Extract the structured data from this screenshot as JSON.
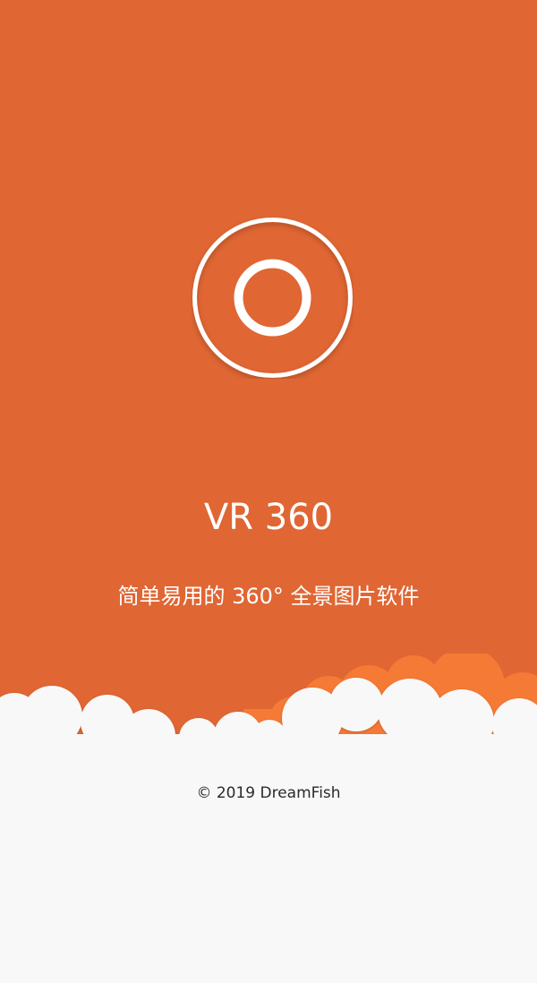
{
  "app": {
    "title": "VR 360",
    "tagline": "简单易用的 360° 全景图片软件",
    "copyright": "© 2019 DreamFish",
    "logo_icon": "circle-lens-icon"
  },
  "colors": {
    "brand_orange": "#E06633",
    "cloud_accent_orange": "#F57A35",
    "cloud_white": "#F8F8F8",
    "text_on_brand": "#FFFFFF",
    "text_dark": "#2A2A2A"
  }
}
